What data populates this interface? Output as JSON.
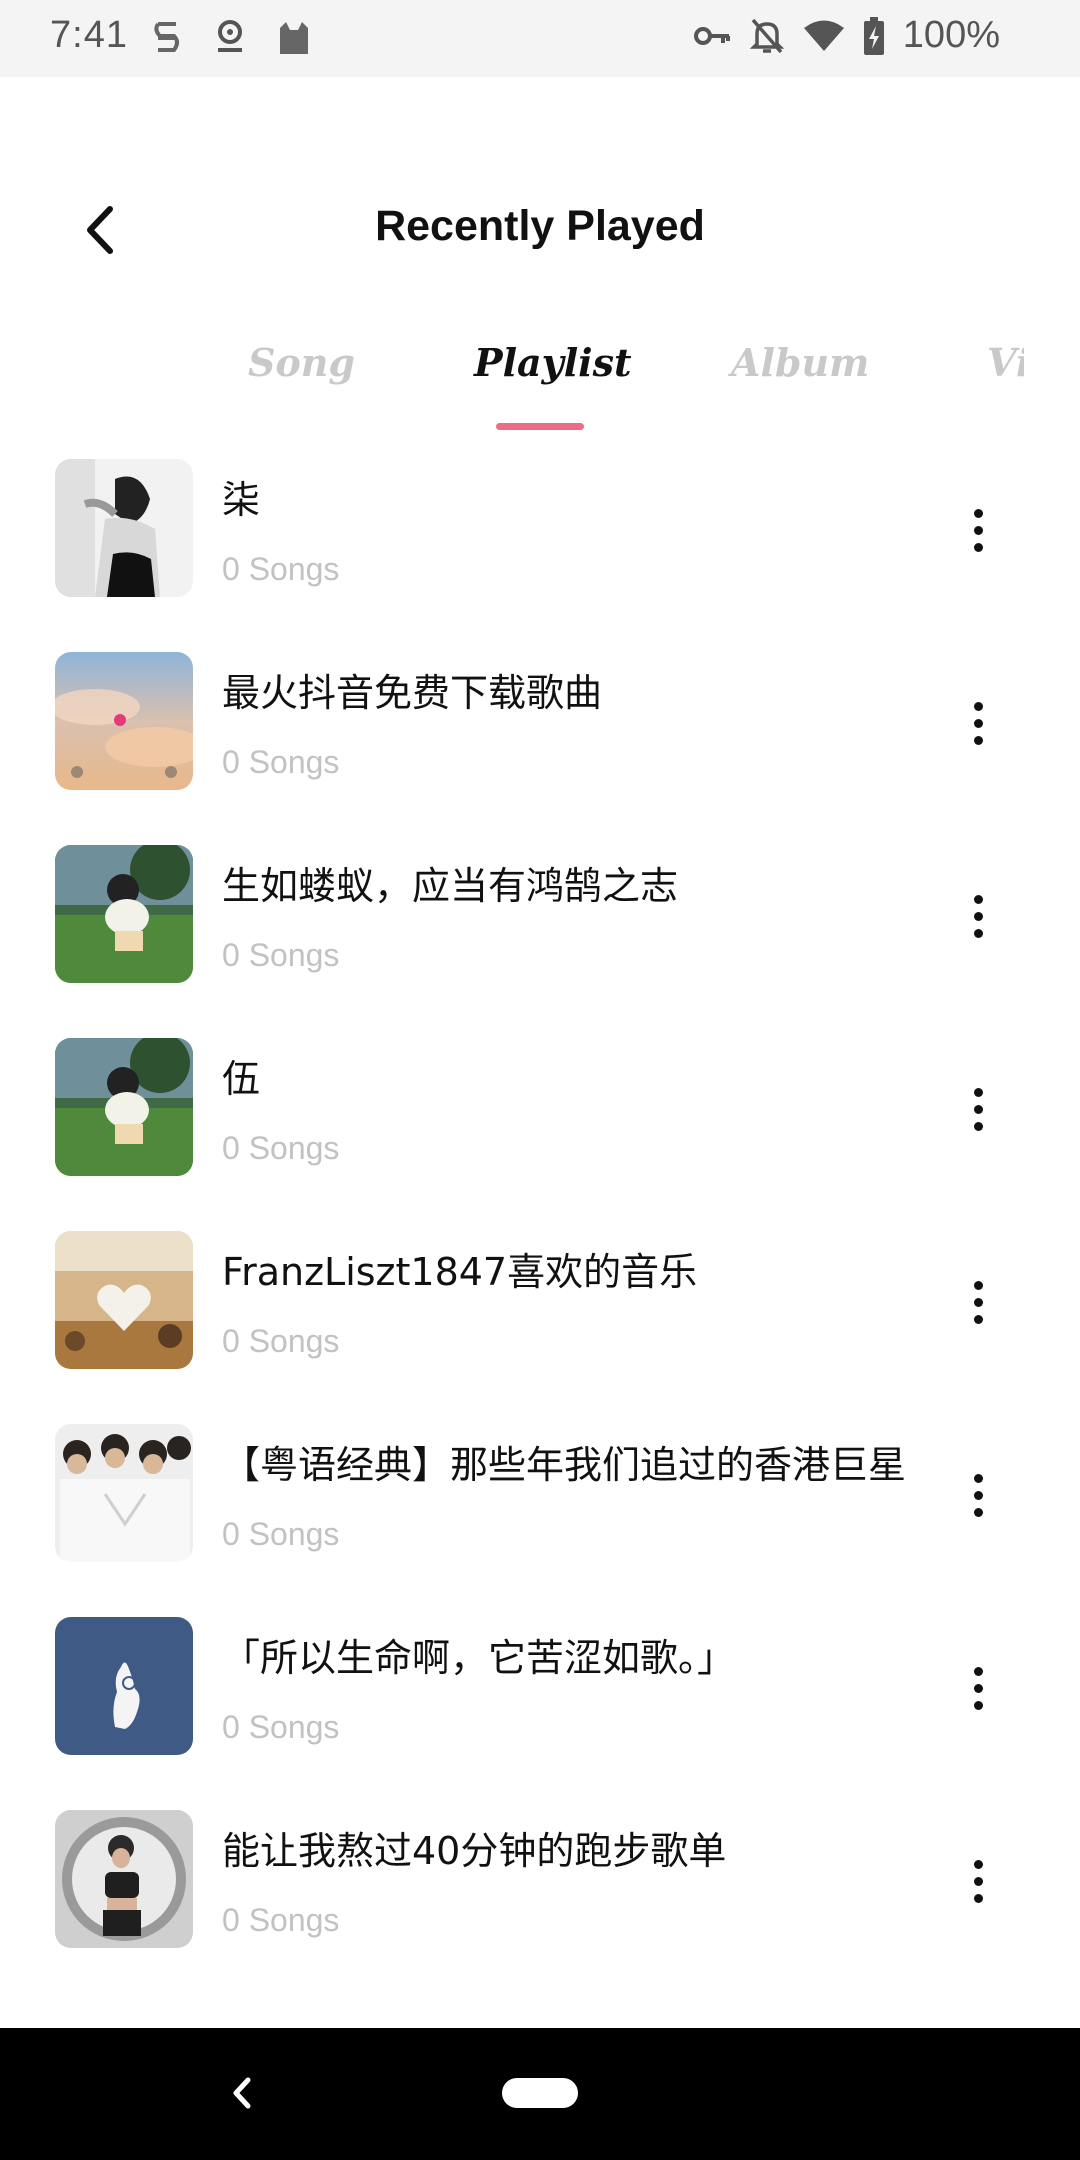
{
  "status_bar": {
    "time": "7:41",
    "left_icons": [
      "sim-icon",
      "radio-app-icon",
      "cat-app-icon"
    ],
    "right_icons": [
      "vpn-key-icon",
      "notifications-off-icon",
      "wifi-icon",
      "battery-charging-icon"
    ],
    "battery": "100%"
  },
  "header": {
    "title": "Recently Played",
    "back_icon": "chevron-left-icon"
  },
  "tabs": [
    {
      "label": "Song",
      "active": false
    },
    {
      "label": "Playlist",
      "active": true
    },
    {
      "label": "Album",
      "active": false
    },
    {
      "label": "Vi",
      "active": false
    }
  ],
  "accent_color": "#ee6b84",
  "playlists": [
    {
      "title": "柒",
      "count": "0 Songs",
      "cover": "grayscale-portrait"
    },
    {
      "title": "最火抖音免费下载歌曲",
      "count": "0 Songs",
      "cover": "sky-clouds"
    },
    {
      "title": "生如蝼蚁，应当有鸿鹄之志",
      "count": "0 Songs",
      "cover": "cartoon-green"
    },
    {
      "title": "伍",
      "count": "0 Songs",
      "cover": "cartoon-green"
    },
    {
      "title": "FranzLiszt1847喜欢的音乐",
      "count": "0 Songs",
      "cover": "vintage-heart"
    },
    {
      "title": "【粤语经典】那些年我们追过的香港巨星",
      "count": "0 Songs",
      "cover": "group-photo"
    },
    {
      "title": "「所以生命啊，它苦涩如歌。」",
      "count": "0 Songs",
      "cover": "blue-hand"
    },
    {
      "title": "能让我熬过40分钟的跑步歌单",
      "count": "0 Songs",
      "cover": "mirror-selfie"
    }
  ],
  "nav_bar": {
    "back_icon": "nav-back-icon",
    "home_icon": "nav-home-pill"
  }
}
